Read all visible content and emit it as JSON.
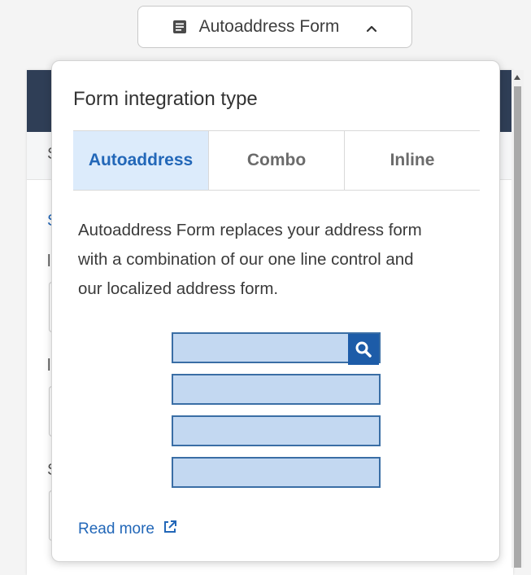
{
  "selector": {
    "label": "Autoaddress Form",
    "icon": "document-icon",
    "chevron": "chevron-up-icon"
  },
  "background": {
    "fragments": [
      "S",
      "S",
      "l",
      "l",
      "S"
    ]
  },
  "popover": {
    "title": "Form integration type",
    "tabs": [
      {
        "label": "Autoaddress",
        "active": true
      },
      {
        "label": "Combo",
        "active": false
      },
      {
        "label": "Inline",
        "active": false
      }
    ],
    "description_lines": [
      "Autoaddress Form replaces your address form",
      "with a combination of our one line control and",
      "our localized address form."
    ],
    "read_more": "Read more"
  },
  "colors": {
    "accent": "#2267b8",
    "field_fill": "#c3d8f1",
    "field_border": "#3a6ea5",
    "header": "#2f3e56"
  }
}
